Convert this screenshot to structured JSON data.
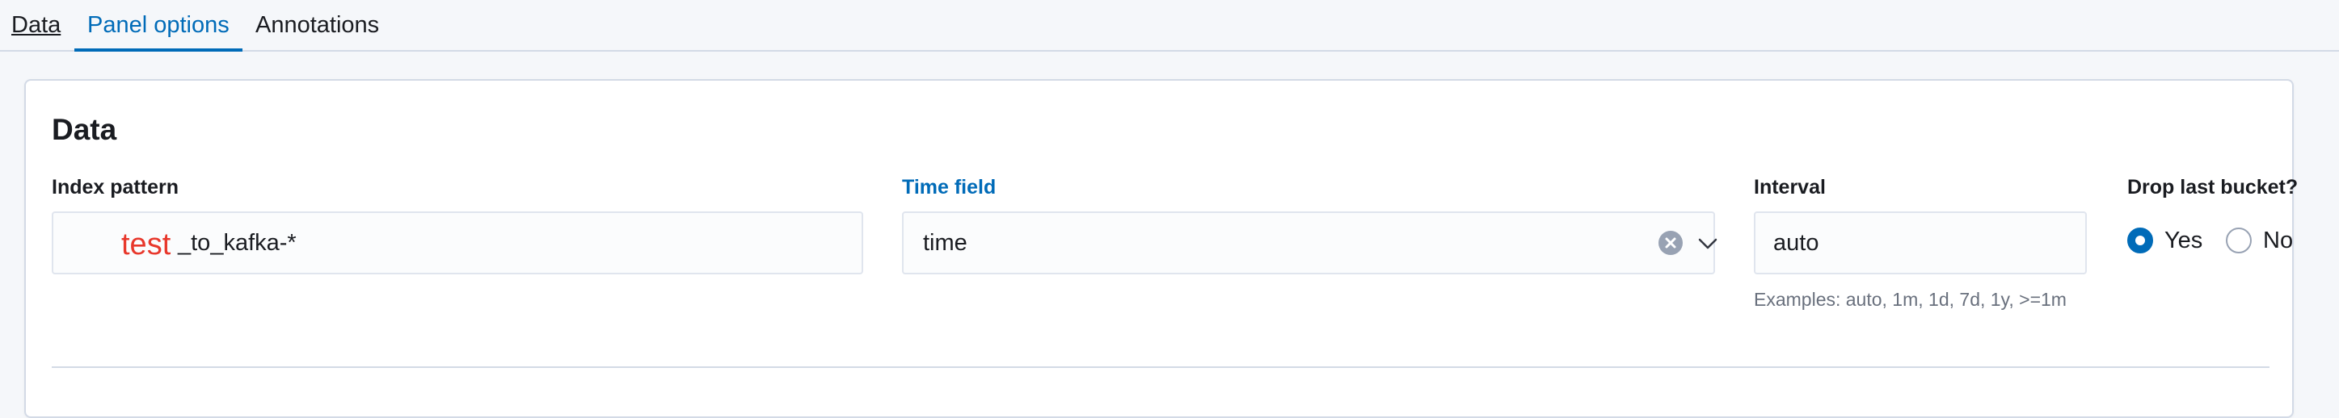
{
  "tabs": [
    {
      "label": "Data"
    },
    {
      "label": "Panel options"
    },
    {
      "label": "Annotations"
    }
  ],
  "section": {
    "title": "Data"
  },
  "fields": {
    "index_pattern": {
      "label": "Index pattern",
      "redacted_text": "test",
      "value_suffix": "_to_kafka-*"
    },
    "time_field": {
      "label": "Time field",
      "value": "time",
      "clear_icon": "clear-icon",
      "dropdown_icon": "chevron-down-icon"
    },
    "interval": {
      "label": "Interval",
      "value": "auto",
      "help": "Examples: auto, 1m, 1d, 7d, 1y, >=1m"
    },
    "drop_last_bucket": {
      "label": "Drop last bucket?",
      "options": [
        {
          "label": "Yes",
          "selected": true
        },
        {
          "label": "No",
          "selected": false
        }
      ]
    }
  },
  "colors": {
    "accent": "#006bb8",
    "redaction_text": "#e8382c",
    "border": "#d3dae6",
    "help_text": "#69707d"
  }
}
